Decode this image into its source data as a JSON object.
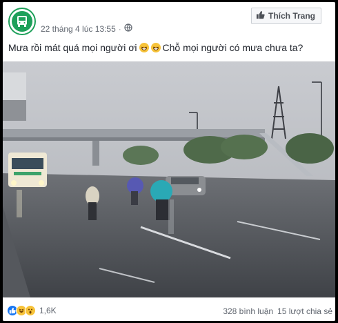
{
  "page": {
    "avatar_text": "",
    "timestamp": "22 tháng 4 lúc 13:55",
    "privacy_icon": "globe-icon",
    "like_button_label": "Thích Trang"
  },
  "post": {
    "text_part1": "Mưa rồi mát quá mọi người ơi",
    "text_part2": "Chỗ mọi người có mưa chưa ta?",
    "emojis": [
      "grinning-face-icon",
      "grinning-face-icon"
    ]
  },
  "footer": {
    "reactions": [
      "like-icon",
      "haha-icon",
      "wow-icon"
    ],
    "reaction_count": "1,6K",
    "comments": "328 bình luận",
    "shares": "15 lượt chia sẻ"
  },
  "colors": {
    "brand_green": "#1ea05a",
    "like_blue": "#1877f2"
  }
}
